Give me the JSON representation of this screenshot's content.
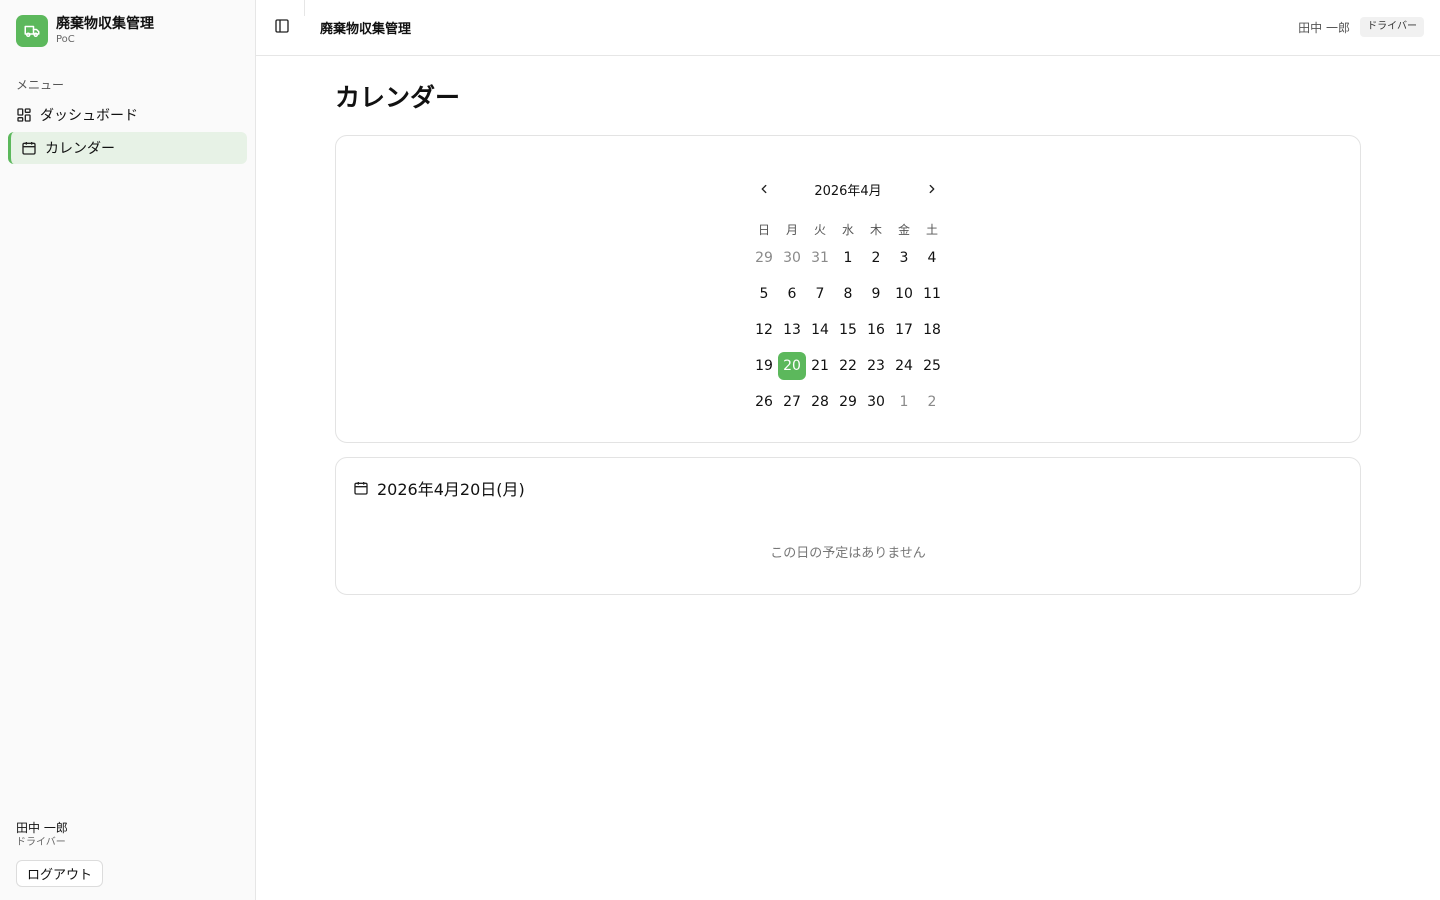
{
  "brand": {
    "name": "廃棄物収集管理",
    "subtitle": "PoC",
    "logo_icon": "truck-icon",
    "color": "#5cb85c"
  },
  "sidebar": {
    "menu_heading": "メニュー",
    "items": [
      {
        "label": "ダッシュボード",
        "icon": "grid-icon",
        "active": false
      },
      {
        "label": "カレンダー",
        "icon": "calendar-icon",
        "active": true
      }
    ],
    "user": {
      "name": "田中 一郎",
      "role": "ドライバー"
    },
    "logout_label": "ログアウト"
  },
  "header": {
    "title": "廃棄物収集管理",
    "user_name": "田中 一郎",
    "role_badge": "ドライバー"
  },
  "main": {
    "page_title": "カレンダー"
  },
  "calendar": {
    "month_label": "2026年4月",
    "weekdays": [
      "日",
      "月",
      "火",
      "水",
      "木",
      "金",
      "土"
    ],
    "weeks": [
      [
        {
          "d": "29",
          "m": true
        },
        {
          "d": "30",
          "m": true
        },
        {
          "d": "31",
          "m": true
        },
        {
          "d": "1"
        },
        {
          "d": "2"
        },
        {
          "d": "3"
        },
        {
          "d": "4"
        }
      ],
      [
        {
          "d": "5"
        },
        {
          "d": "6"
        },
        {
          "d": "7"
        },
        {
          "d": "8"
        },
        {
          "d": "9"
        },
        {
          "d": "10"
        },
        {
          "d": "11"
        }
      ],
      [
        {
          "d": "12"
        },
        {
          "d": "13"
        },
        {
          "d": "14"
        },
        {
          "d": "15"
        },
        {
          "d": "16"
        },
        {
          "d": "17"
        },
        {
          "d": "18"
        }
      ],
      [
        {
          "d": "19"
        },
        {
          "d": "20",
          "s": true
        },
        {
          "d": "21"
        },
        {
          "d": "22"
        },
        {
          "d": "23"
        },
        {
          "d": "24"
        },
        {
          "d": "25"
        }
      ],
      [
        {
          "d": "26"
        },
        {
          "d": "27"
        },
        {
          "d": "28"
        },
        {
          "d": "29"
        },
        {
          "d": "30"
        },
        {
          "d": "1",
          "m": true
        },
        {
          "d": "2",
          "m": true
        }
      ]
    ],
    "selected_color": "#5cb85c"
  },
  "day_detail": {
    "date_label": "2026年4月20日(月)",
    "empty_message": "この日の予定はありません"
  }
}
